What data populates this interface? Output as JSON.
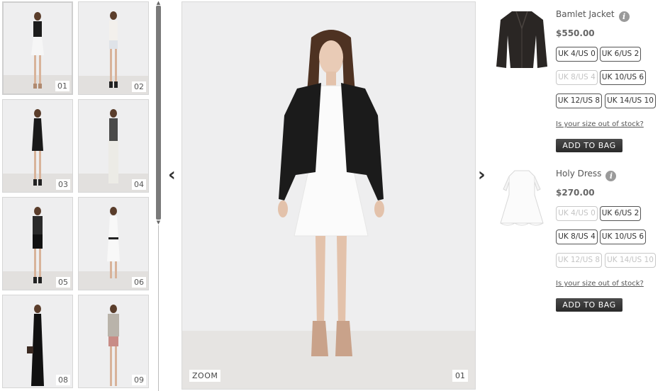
{
  "thumbnails": [
    {
      "num": "01",
      "outfit": "jacket-dress"
    },
    {
      "num": "02",
      "outfit": "white-shorts"
    },
    {
      "num": "03",
      "outfit": "black-dress"
    },
    {
      "num": "04",
      "outfit": "grey-tank"
    },
    {
      "num": "05",
      "outfit": "black-shorts"
    },
    {
      "num": "06",
      "outfit": "white-dress-belt"
    },
    {
      "num": "08",
      "outfit": "black-dress-clutch"
    },
    {
      "num": "09",
      "outfit": "knit-shorts"
    }
  ],
  "main": {
    "zoom_label": "ZOOM",
    "image_num": "01",
    "prev_arrow": "‹",
    "next_arrow": "›"
  },
  "products": [
    {
      "name": "Bamlet Jacket",
      "price": "$550.00",
      "sizes": [
        {
          "label": "UK 4/US 0",
          "available": true
        },
        {
          "label": "UK 6/US 2",
          "available": true
        },
        {
          "label": "UK 8/US 4",
          "available": false
        },
        {
          "label": "UK 10/US 6",
          "available": true
        },
        {
          "label": "UK 12/US 8",
          "available": true
        },
        {
          "label": "UK 14/US 10",
          "available": true
        }
      ],
      "stock_link": "Is your size out of stock?",
      "add_button": "ADD TO BAG"
    },
    {
      "name": "Holy Dress",
      "price": "$270.00",
      "sizes": [
        {
          "label": "UK 4/US 0",
          "available": false
        },
        {
          "label": "UK 6/US 2",
          "available": true
        },
        {
          "label": "UK 8/US 4",
          "available": true
        },
        {
          "label": "UK 10/US 6",
          "available": true
        },
        {
          "label": "UK 12/US 8",
          "available": false
        },
        {
          "label": "UK 14/US 10",
          "available": false
        }
      ],
      "stock_link": "Is your size out of stock?",
      "add_button": "ADD TO BAG"
    }
  ],
  "colors": {
    "backdrop": "#eeeeef",
    "floor": "#e4e2e0",
    "button_dark": "#333333",
    "out_of_stock": "#c4c4c4"
  }
}
